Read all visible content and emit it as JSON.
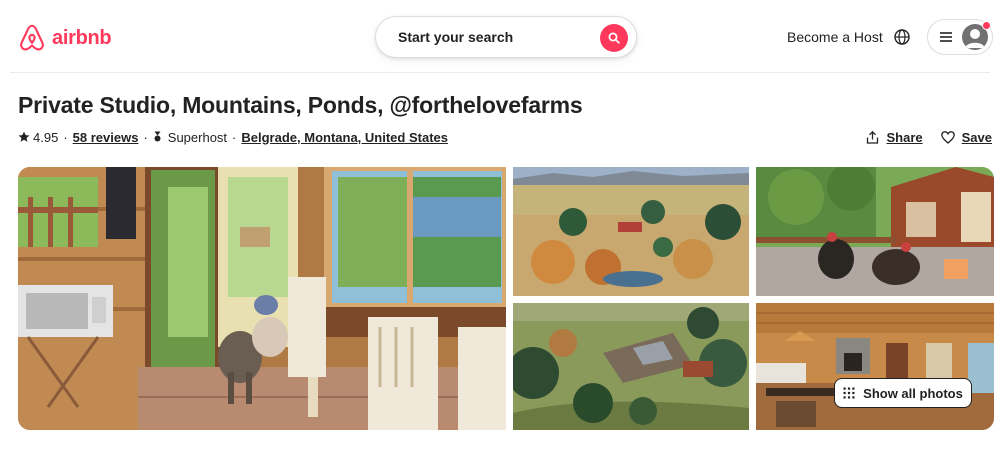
{
  "header": {
    "logo_text": "airbnb",
    "search_placeholder": "Start your search",
    "host_link": "Become a Host"
  },
  "listing": {
    "title": "Private Studio, Mountains, Ponds, @forthelovefarms",
    "rating": "4.95",
    "reviews": "58 reviews",
    "superhost": "Superhost",
    "location": "Belgrade, Montana, United States",
    "share_label": "Share",
    "save_label": "Save"
  },
  "gallery": {
    "show_all_label": "Show all photos",
    "photos": [
      "studio-interior-goats",
      "ranch-aerial-fall",
      "turkeys-on-patio",
      "ranch-aerial-house",
      "cabin-kitchen-interior"
    ]
  },
  "colors": {
    "brand": "#ff385c",
    "text": "#222222",
    "border": "#dddddd"
  }
}
